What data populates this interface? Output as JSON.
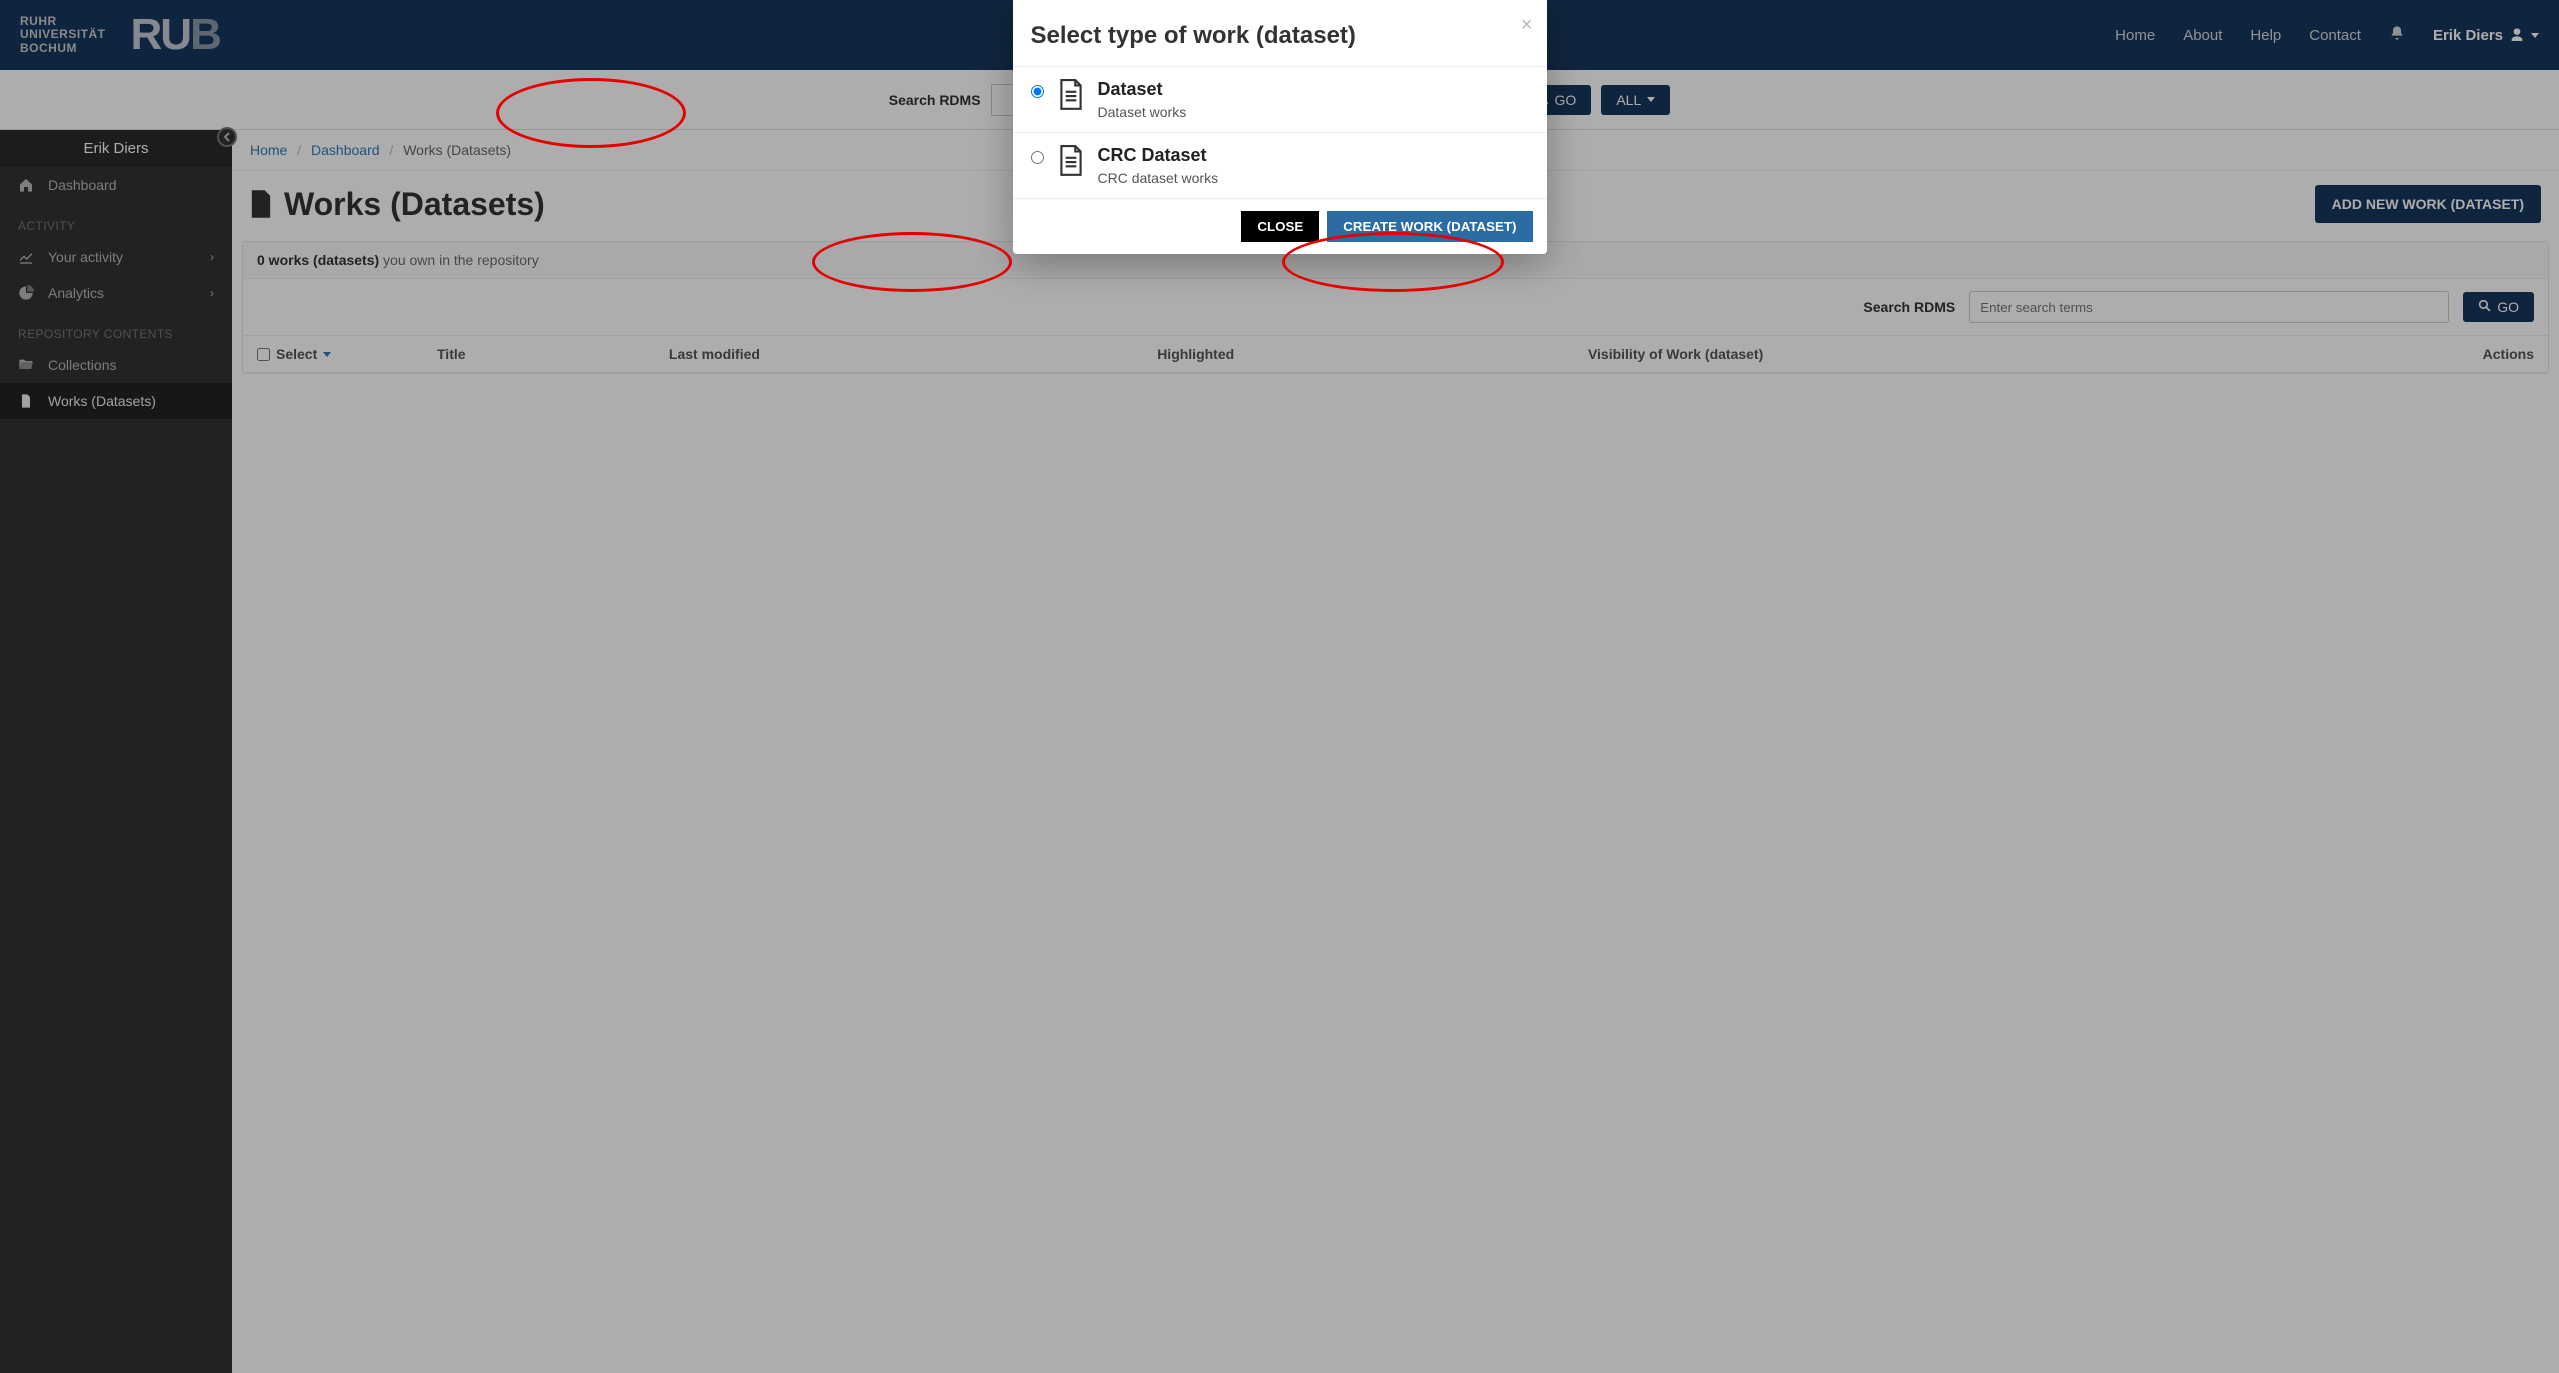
{
  "topnav": {
    "brand_line1": "RUHR",
    "brand_line2": "UNIVERSITÄT",
    "brand_line3": "BOCHUM",
    "logo_ru": "RU",
    "logo_b": "B",
    "links": {
      "home": "Home",
      "about": "About",
      "help": "Help",
      "contact": "Contact"
    },
    "user_name": "Erik Diers"
  },
  "searchbar": {
    "label": "Search RDMS",
    "go": "GO",
    "all": "ALL"
  },
  "sidebar": {
    "user": "Erik Diers",
    "dashboard": "Dashboard",
    "heading_activity": "ACTIVITY",
    "your_activity": "Your activity",
    "analytics": "Analytics",
    "heading_repo": "REPOSITORY CONTENTS",
    "collections": "Collections",
    "works": "Works (Datasets)"
  },
  "breadcrumb": {
    "home": "Home",
    "dashboard": "Dashboard",
    "current": "Works (Datasets)"
  },
  "page": {
    "title": "Works (Datasets)",
    "add_button": "ADD NEW WORK (DATASET)",
    "panel_count_bold": "0 works (datasets)",
    "panel_count_rest": " you own in the repository",
    "search_label": "Search RDMS",
    "search_placeholder": "Enter search terms",
    "go": "GO",
    "cols": {
      "select": "Select",
      "title": "Title",
      "last_modified": "Last modified",
      "highlighted": "Highlighted",
      "visibility": "Visibility of Work (dataset)",
      "actions": "Actions"
    }
  },
  "modal": {
    "title": "Select type of work (dataset)",
    "opt1_title": "Dataset",
    "opt1_desc": "Dataset works",
    "opt2_title": "CRC Dataset",
    "opt2_desc": "CRC dataset works",
    "close": "CLOSE",
    "create": "CREATE WORK (DATASET)"
  }
}
